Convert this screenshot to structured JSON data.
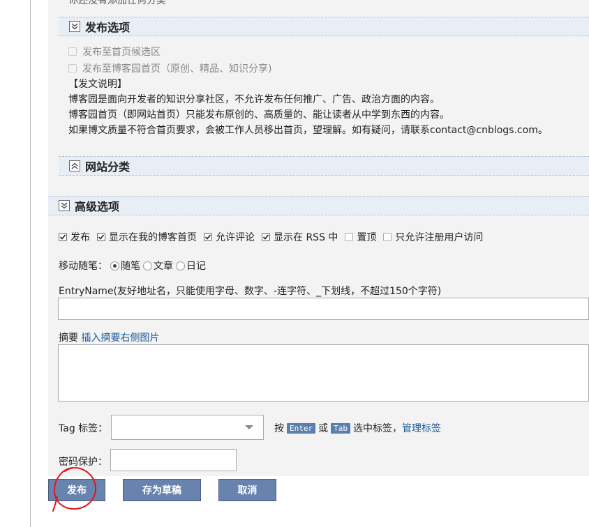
{
  "partial_top_text": "你还没有添加任何分类",
  "publish_options": {
    "title": "发布选项",
    "items": [
      {
        "label": "发布至首页候选区"
      },
      {
        "label": "发布至博客园首页（原创、精品、知识分享)"
      }
    ],
    "notes": [
      "【发文说明】",
      "博客园是面向开发者的知识分享社区，不允许发布任何推广、广告、政治方面的内容。",
      "博客园首页（即网站首页）只能发布原创的、高质量的、能让读者从中学到东西的内容。",
      "如果博文质量不符合首页要求，会被工作人员移出首页，望理解。如有疑问，请联系contact@cnblogs.com。"
    ]
  },
  "site_category": {
    "title": "网站分类"
  },
  "advanced": {
    "title": "高级选项",
    "options": [
      {
        "label": "发布",
        "checked": true
      },
      {
        "label": "显示在我的博客首页",
        "checked": true
      },
      {
        "label": "允许评论",
        "checked": true
      },
      {
        "label": "显示在 RSS 中",
        "checked": true
      },
      {
        "label": "置顶",
        "checked": false
      },
      {
        "label": "只允许注册用户访问",
        "checked": false
      }
    ],
    "move_label": "移动随笔：",
    "move_options": [
      {
        "label": "随笔",
        "selected": true
      },
      {
        "label": "文章",
        "selected": false
      },
      {
        "label": "日记",
        "selected": false
      }
    ],
    "entry_name_label": "EntryName(友好地址名，只能使用字母、数字、-连字符、_下划线，不超过150个字符)",
    "entry_name_value": "",
    "summary_label": "摘要",
    "summary_link": "插入摘要右侧图片",
    "summary_value": "",
    "tag_label": "Tag 标签：",
    "tag_value": "",
    "tag_hint_press": "按",
    "tag_key_enter": "Enter",
    "tag_hint_or": "或",
    "tag_key_tab": "Tab",
    "tag_hint_select": "选中标签，",
    "tag_manage_link": "管理标签",
    "password_label": "密码保护：",
    "password_value": ""
  },
  "buttons": {
    "publish": "发布",
    "save_draft": "存为草稿",
    "cancel": "取消"
  },
  "colors": {
    "section_bar": "#e8eef6",
    "button": "#6883ad",
    "link": "#1a5a9a",
    "annotation": "#e0161b"
  }
}
